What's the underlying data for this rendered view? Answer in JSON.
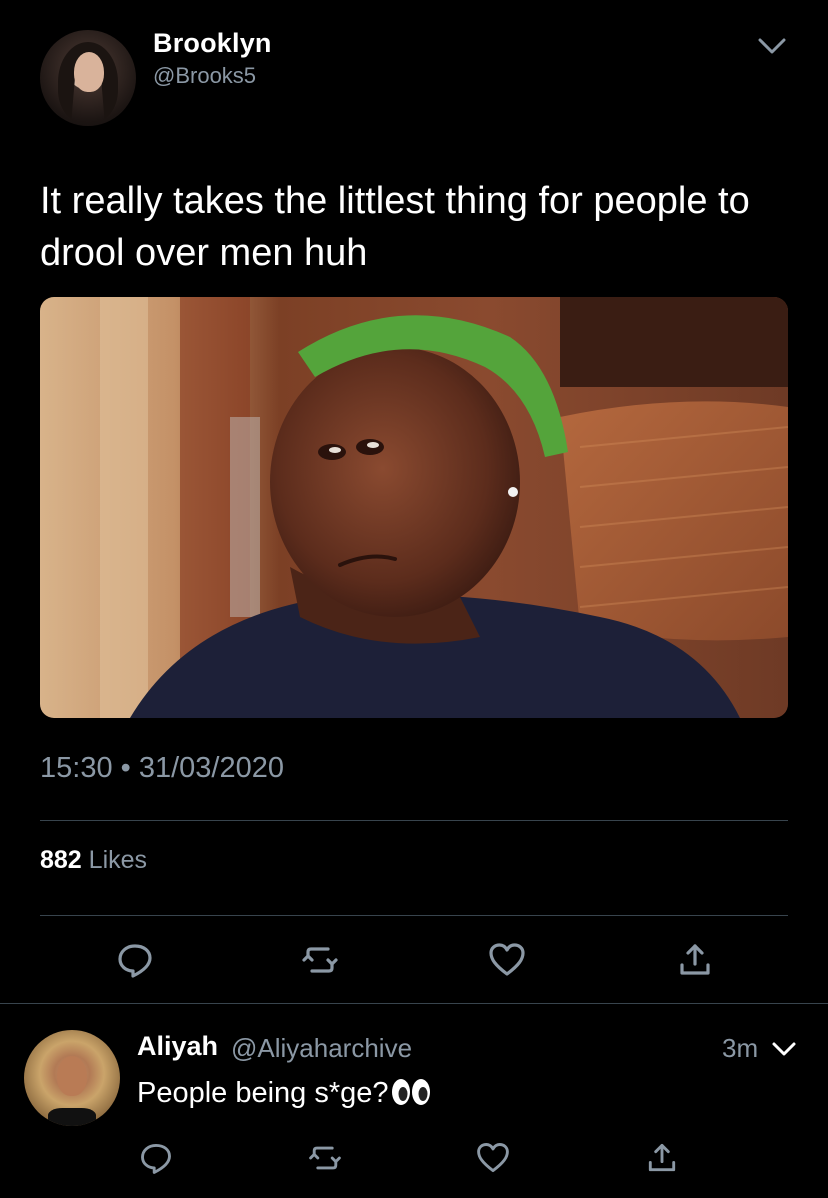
{
  "tweet": {
    "author_name": "Brooklyn",
    "author_handle": "@Brooks5",
    "text": "It really takes the littlest thing for people to drool over men huh",
    "timestamp": "15:30 • 31/03/2020",
    "likes_count": "882",
    "likes_label": "Likes",
    "avatar_icon": "profile-photo",
    "menu_icon": "chevron-down-icon",
    "actions": [
      {
        "icon": "reply-icon"
      },
      {
        "icon": "retweet-icon"
      },
      {
        "icon": "like-icon"
      },
      {
        "icon": "share-icon"
      }
    ]
  },
  "reply": {
    "author_name": "Aliyah",
    "author_handle": "@Aliyaharchive",
    "time": "3m",
    "text": "People being s*ge?",
    "emoji": "👀",
    "menu_icon": "chevron-down-icon",
    "actions": [
      {
        "icon": "reply-icon"
      },
      {
        "icon": "retweet-icon"
      },
      {
        "icon": "like-icon"
      },
      {
        "icon": "share-icon"
      }
    ]
  },
  "colors": {
    "background": "#000000",
    "primary_text": "#ffffff",
    "secondary_text": "#8b98a5",
    "divider": "#38444d"
  }
}
